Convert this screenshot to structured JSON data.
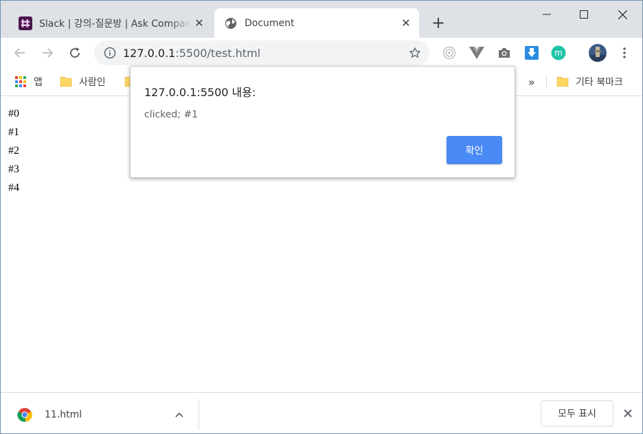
{
  "tabs": [
    {
      "title": "Slack | 강의-질문방 | Ask Company",
      "active": false,
      "favicon": "slack-icon"
    },
    {
      "title": "Document",
      "active": true,
      "favicon": "globe-icon"
    }
  ],
  "toolbar": {
    "url_host": "127.0.0.1",
    "url_path": ":5500/test.html"
  },
  "bookmarks": {
    "apps_label": "앱",
    "items": [
      "사람인"
    ],
    "overflow": "»",
    "other": "기타 북마크"
  },
  "content": {
    "lines": [
      "#0",
      "#1",
      "#2",
      "#3",
      "#4"
    ]
  },
  "dialog": {
    "heading": "127.0.0.1:5500 내용:",
    "message": "clicked; #1",
    "ok_label": "확인"
  },
  "download_shelf": {
    "file_name": "11.html",
    "show_all_label": "모두 표시"
  },
  "colors": {
    "tabstrip": "#dee1e6",
    "accent_button": "#4a8af4",
    "slack_purple": "#4a154b"
  }
}
